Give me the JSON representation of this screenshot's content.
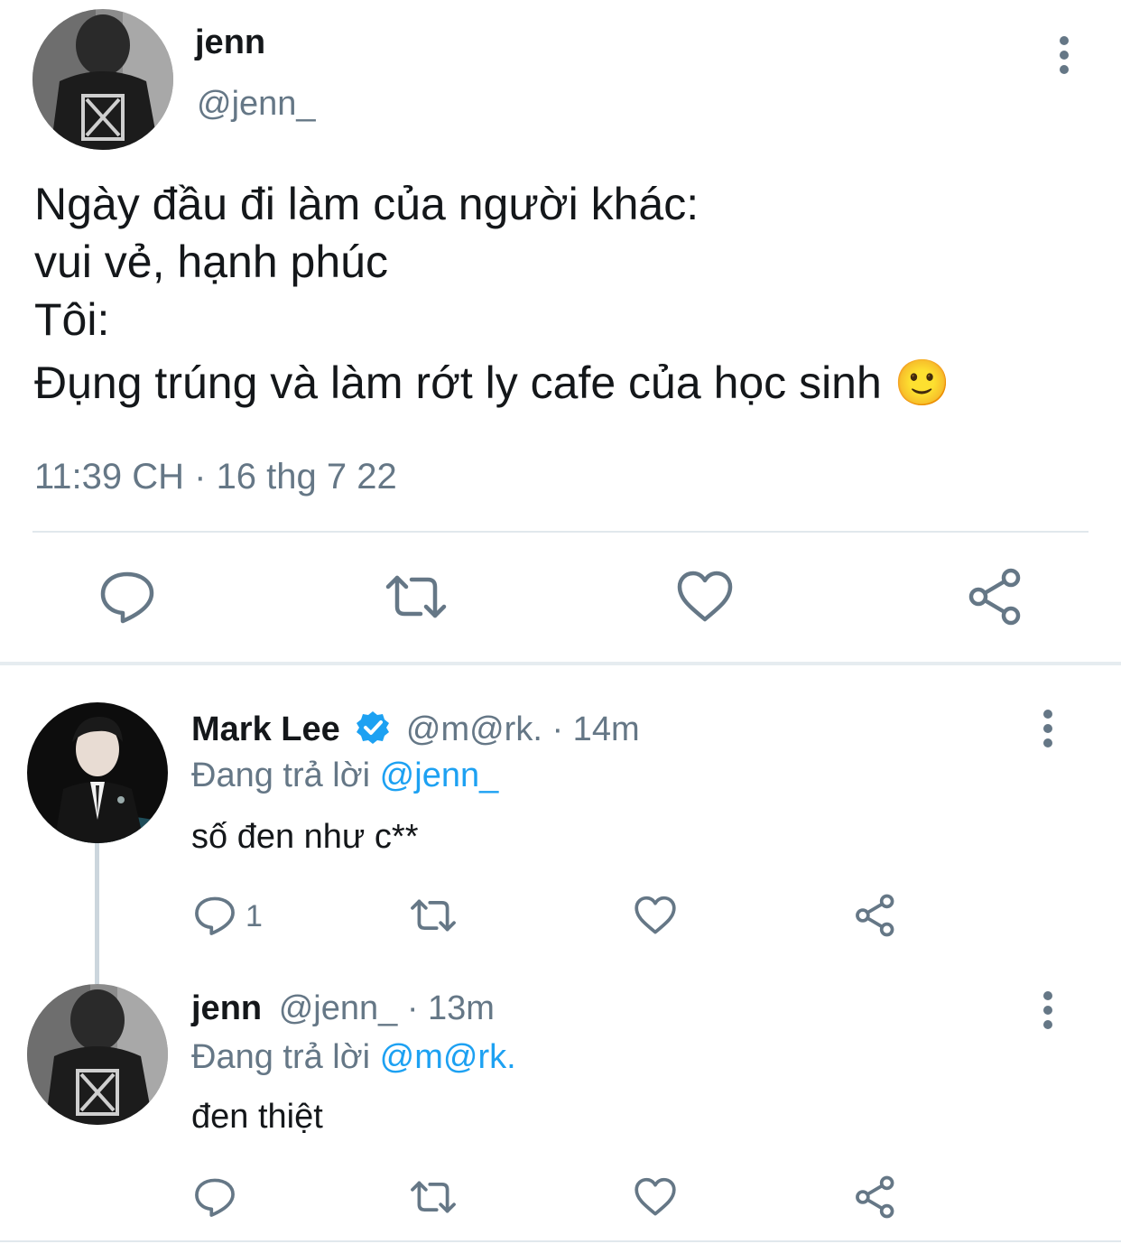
{
  "main_tweet": {
    "author_name": "jenn",
    "author_handle": "@jenn_",
    "text_lines": [
      "Ngày đầu đi làm của người khác:",
      "vui vẻ, hạnh phúc",
      "Tôi:",
      "Đụng trúng và làm rớt ly cafe của học sinh 🙂"
    ],
    "timestamp": "11:39 CH · 16 thg 7 22",
    "actions": [
      "reply-icon",
      "retweet-icon",
      "like-icon",
      "share-icon"
    ]
  },
  "replies": [
    {
      "author_name": "Mark Lee",
      "verified": true,
      "author_handle": "@m@rk.",
      "time": "· 14m",
      "replying_prefix": "Đang trả lời",
      "replying_to": "@jenn_",
      "text": "số đen như c**",
      "reply_count": "1"
    },
    {
      "author_name": "jenn",
      "verified": false,
      "author_handle": "@jenn_",
      "time": "· 13m",
      "replying_prefix": "Đang trả lời",
      "replying_to": "@m@rk.",
      "text": "đen thiệt",
      "reply_count": ""
    }
  ],
  "colors": {
    "text": "#14171a",
    "secondary": "#657786",
    "accent": "#1da1f2",
    "divider": "#e1e8ed"
  }
}
